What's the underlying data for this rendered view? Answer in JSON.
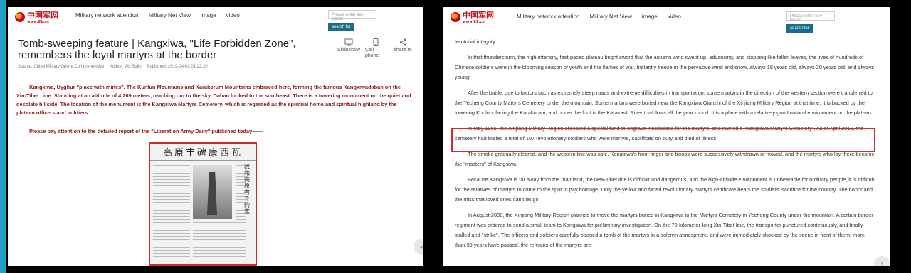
{
  "logo": {
    "text": "中国军网",
    "sub": "www.81.cn"
  },
  "nav": {
    "items": [
      "Military network attention",
      "Military Net View",
      "image",
      "video"
    ]
  },
  "search": {
    "placeholder": "Please enter key words",
    "button": "search for"
  },
  "left": {
    "title": "Tomb-sweeping feature | Kangxiwa, \"Life Forbidden Zone\", remembers the loyal martyrs at the border",
    "meta": {
      "source": "Source: China Military Online Comprehensive",
      "author": "Author: Wu Sulin",
      "published": "Published: 2019-04-03 01:22:20"
    },
    "tools": {
      "slideshow": "Slideshow",
      "cell_phone": "Cell phone",
      "share_to": "share to"
    },
    "lead": "Kangxiwa, Uyghur \"place with mines\". The Kunlun Mountains and Karakorum Mountains embraced here, forming the famous Kangxiwadaban on the Xin-Tibet Line. Standing at an altitude of 4,269 meters, reaching out to the sky, Daban looked to the southeast. There is a towering monument on the quiet and desolate hillside. The location of the monument is the Kangsiwa Martyrs Cemetery, which is regarded as the spiritual home and spiritual highland by the plateau officers and soldiers.",
    "attention": "Please pay attention to the detailed report of the \"Liberation Army Daily\" published today——",
    "newspaper_headline": "高原丰碑康西瓦",
    "newspaper_side": "我和高原有个约定"
  },
  "right": {
    "paragraphs": [
      "territorial integrity.",
      "In that thunderstorm, the high-intensity, fast-paced plateau bright sword that the autumn wind swept up, advancing, and stopping like fallen leaves, the lives of hundreds of Chinese soldiers were in the blooming season of youth and the flames of war. Instantly freeze in the pervasive wind and snow, always 18 years old, always 20 years old, and always young!",
      "After the battle, due to factors such as extremely steep roads and extreme difficulties in transportation, some martyrs in the direction of the western section were transferred to the Yecheng County Martyrs Cemetery under the mountain. Some martyrs were buried near the Kangxiwa Qianzhi of the Xinjiang Military Region at that time. It is backed by the towering Kunlun, facing the Karakoram, and under the foot is the Karakash River that flows all the year round. It is a place with a relatively good natural environment on the plateau.",
      "In May 1965, the Xinjiang Military Region allocated a special fund to engrave inscriptions for the martyrs, and named it \"Kangxiwa Martyrs Cemetery\". As of April 2019, the cemetery had buried a total of 107 revolutionary soldiers who were martyrs, sacrificed on duty and died of illness.",
      "The smoke gradually cleared, and the western line was safe. Kangsiwa’s front finger and troops were successively withdrawn or moved, and the martyrs who lay there became the \"masters\" of Kangsiwa.",
      "Because Kangsiwa is far away from the mainland, the new-Tibet line is difficult and dangerous, and the high-altitude environment is unbearable for ordinary people, it is difficult for the relatives of martyrs to come to the spot to pay homage. Only the yellow and faded revolutionary martyrs certificate bears the soldiers' sacrifice for the country. The honor and the miss that loved ones can’t let go.",
      "In August 2000, the Xinjiang Military Region planned to move the martyrs buried in Kangxiwa to the Martyrs Cemetery in Yecheng County under the mountain. A certain border regiment was ordered to send a small team to Kangsiwa for preliminary investigation. On the 70-kilometer-long Xin-Tibet line, the transporter punctured continuously, and finally stalled and \"strike\". The officers and soldiers carefully opened a tomb of the martyrs in a solemn atmosphere, and were immediately shocked by the scene in front of them: more than 30 years have passed, the remains of the martyrs are"
    ]
  },
  "colors": {
    "accent": "#d12b2b",
    "lead_text": "#8b1a1a",
    "search_button": "#1a6e8a",
    "side_bar": "#1fa0c2"
  }
}
